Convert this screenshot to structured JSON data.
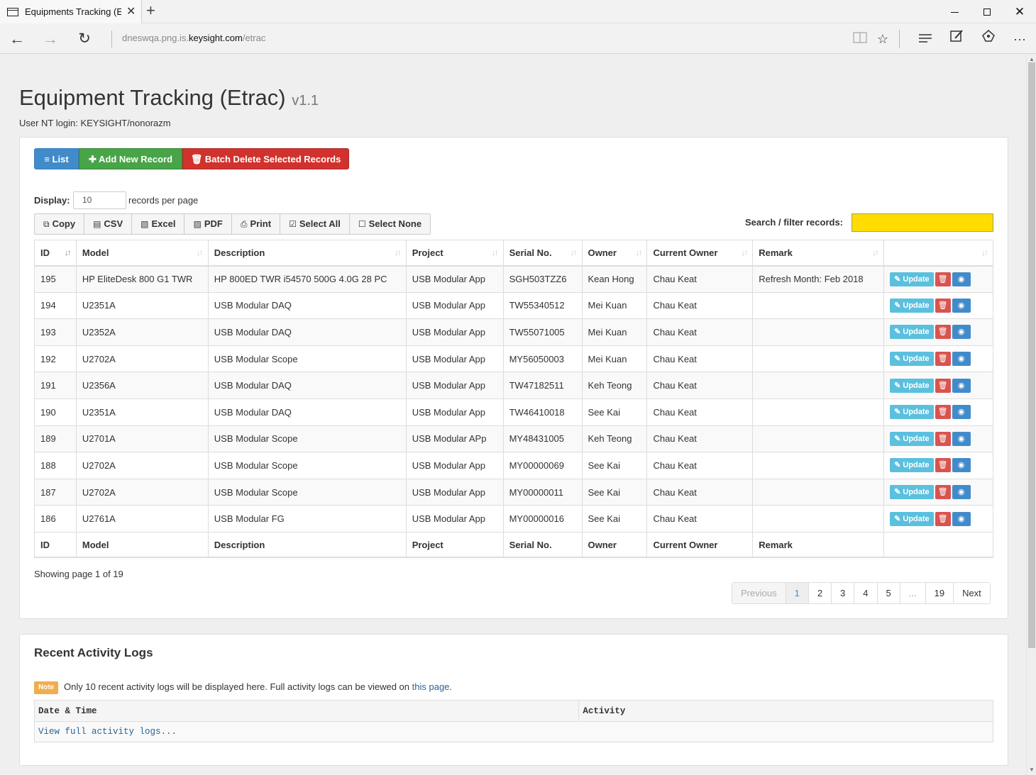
{
  "browser": {
    "tab_title": "Equipments Tracking (Et",
    "tab_close": "✕",
    "new_tab": "+",
    "url_prefix": "dneswqa.png.is.",
    "url_domain": "keysight.com",
    "url_suffix": "/etrac"
  },
  "header": {
    "title": "Equipment Tracking (Etrac)",
    "version": "v1.1",
    "login": "User NT login: KEYSIGHT/nonorazm"
  },
  "actions": {
    "list": "List",
    "add": "Add New Record",
    "batch_delete": "Batch Delete Selected Records"
  },
  "display": {
    "label": "Display:",
    "value": "10",
    "suffix": "records per page"
  },
  "export_buttons": [
    "Copy",
    "CSV",
    "Excel",
    "PDF",
    "Print",
    "Select All",
    "Select None"
  ],
  "search": {
    "label": "Search / filter records:",
    "value": "",
    "highlight_color": "#ffdd00"
  },
  "table": {
    "columns": [
      "ID",
      "Model",
      "Description",
      "Project",
      "Serial No.",
      "Owner",
      "Current Owner",
      "Remark",
      ""
    ],
    "rows": [
      [
        "195",
        "HP EliteDesk 800 G1 TWR",
        "HP 800ED TWR i54570 500G 4.0G 28 PC",
        "USB Modular App",
        "SGH503TZZ6",
        "Kean Hong",
        "Chau Keat",
        "Refresh Month: Feb 2018"
      ],
      [
        "194",
        "U2351A",
        "USB Modular DAQ",
        "USB Modular App",
        "TW55340512",
        "Mei Kuan",
        "Chau Keat",
        ""
      ],
      [
        "193",
        "U2352A",
        "USB Modular DAQ",
        "USB Modular App",
        "TW55071005",
        "Mei Kuan",
        "Chau Keat",
        ""
      ],
      [
        "192",
        "U2702A",
        "USB Modular Scope",
        "USB Modular App",
        "MY56050003",
        "Mei Kuan",
        "Chau Keat",
        ""
      ],
      [
        "191",
        "U2356A",
        "USB Modular DAQ",
        "USB Modular App",
        "TW47182511",
        "Keh Teong",
        "Chau Keat",
        ""
      ],
      [
        "190",
        "U2351A",
        "USB Modular DAQ",
        "USB Modular App",
        "TW46410018",
        "See Kai",
        "Chau Keat",
        ""
      ],
      [
        "189",
        "U2701A",
        "USB Modular Scope",
        "USB Modular APp",
        "MY48431005",
        "Keh Teong",
        "Chau Keat",
        ""
      ],
      [
        "188",
        "U2702A",
        "USB Modular Scope",
        "USB Modular App",
        "MY00000069",
        "See Kai",
        "Chau Keat",
        ""
      ],
      [
        "187",
        "U2702A",
        "USB Modular Scope",
        "USB Modular App",
        "MY00000011",
        "See Kai",
        "Chau Keat",
        ""
      ],
      [
        "186",
        "U2761A",
        "USB Modular FG",
        "USB Modular App",
        "MY00000016",
        "See Kai",
        "Chau Keat",
        ""
      ]
    ],
    "update_label": "Update"
  },
  "paging": {
    "showing": "Showing page 1 of 19",
    "pages": [
      "Previous",
      "1",
      "2",
      "3",
      "4",
      "5",
      "...",
      "19",
      "Next"
    ],
    "current": "1"
  },
  "logs": {
    "title": "Recent Activity Logs",
    "note_badge": "Note",
    "note_text": "Only 10 recent activity logs will be displayed here. Full activity logs can be viewed on ",
    "note_link": "this page",
    "note_end": ".",
    "columns": [
      "Date & Time",
      "Activity"
    ],
    "view_all": "View full activity logs..."
  },
  "colors": {
    "primary": "#428bca",
    "success": "#47a447",
    "danger": "#d2322d",
    "info": "#5bc0de",
    "warning": "#f0ad4e"
  }
}
